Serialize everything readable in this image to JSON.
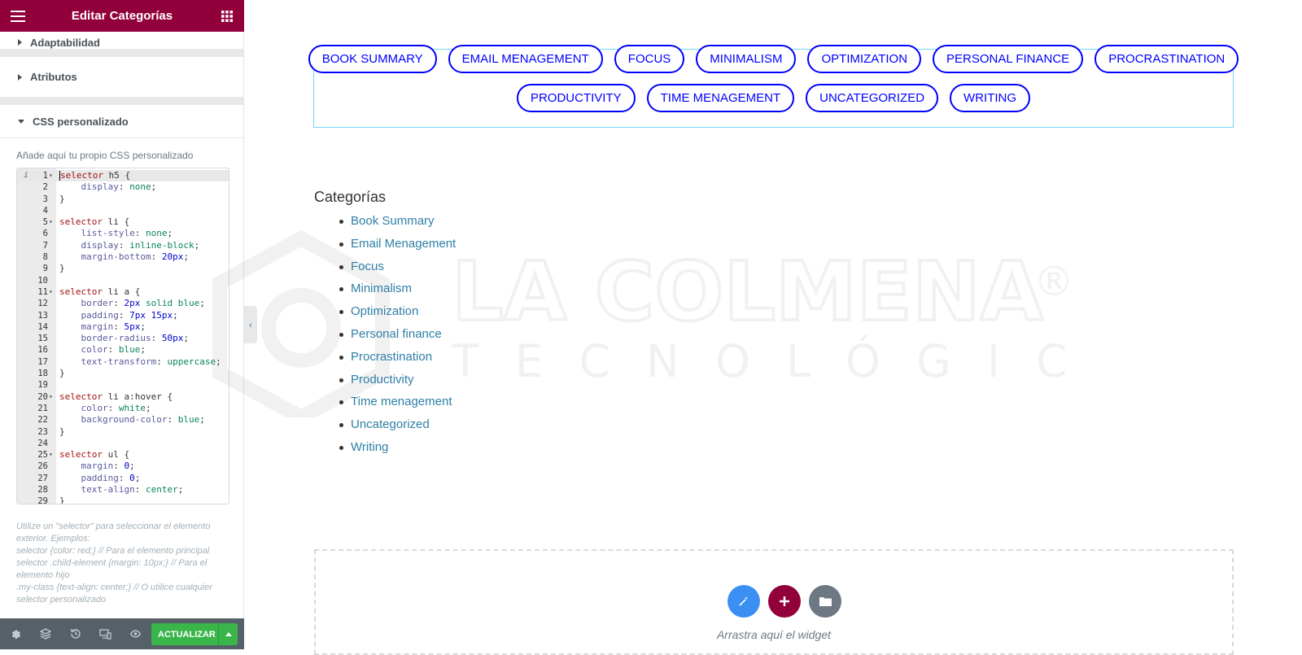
{
  "panel": {
    "title": "Editar Categorías",
    "sections": {
      "adaptability": "Adaptabilidad",
      "attributes": "Atributos",
      "custom_css": "CSS personalizado"
    },
    "custom_css_description": "Añade aquí tu propio CSS personalizado",
    "code_lines": [
      "selector h5 {",
      "    display: none;",
      "}",
      "",
      "selector li {",
      "    list-style: none;",
      "    display: inline-block;",
      "    margin-bottom: 20px;",
      "}",
      "",
      "selector li a {",
      "    border: 2px solid blue;",
      "    padding: 7px 15px;",
      "    margin: 5px;",
      "    border-radius: 50px;",
      "    color: blue;",
      "    text-transform: uppercase;",
      "}",
      "",
      "selector li a:hover {",
      "    color: white;",
      "    background-color: blue;",
      "}",
      "",
      "selector ul {",
      "    margin: 0;",
      "    padding: 0;",
      "    text-align: center;",
      "}"
    ],
    "help_lines": [
      "Utilize un \"selector\" para seleccionar el elemento exterior. Ejemplos:",
      "selector {color: red;} // Para el elemento principal",
      "selector .child-element {margin: 10px;} // Para el elemento hijo",
      ".my-class {text-align: center;} // O utilice cualquier selector personalizado"
    ],
    "footer": {
      "icons": [
        "gear-icon",
        "layers-icon",
        "history-icon",
        "responsive-icon",
        "eye-icon"
      ],
      "update_label": "ACTUALIZAR"
    }
  },
  "canvas": {
    "category_pills_row1": [
      "Book Summary",
      "Email Menagement",
      "Focus",
      "Minimalism",
      "Optimization",
      "Personal finance",
      "Procrastination"
    ],
    "category_pills_row2": [
      "Productivity",
      "Time menagement",
      "Uncategorized",
      "Writing"
    ],
    "list_title": "Categorías",
    "list_items": [
      "Book Summary",
      "Email Menagement",
      "Focus",
      "Minimalism",
      "Optimization",
      "Personal finance",
      "Procrastination",
      "Productivity",
      "Time menagement",
      "Uncategorized",
      "Writing"
    ],
    "drop_zone_text": "Arrastra aquí el widget"
  },
  "watermark": {
    "line1": "LA COLMENA",
    "line2": "TECNOLÓGICA",
    "registered": "®"
  },
  "colors": {
    "panel_header": "#92003b",
    "update_button": "#39b54a",
    "pill_blue": "#0000ff",
    "link": "#2e7fa6",
    "dz_blue": "#3b8ff2",
    "dz_maroon": "#92003b",
    "dz_gray": "#6d7882"
  }
}
